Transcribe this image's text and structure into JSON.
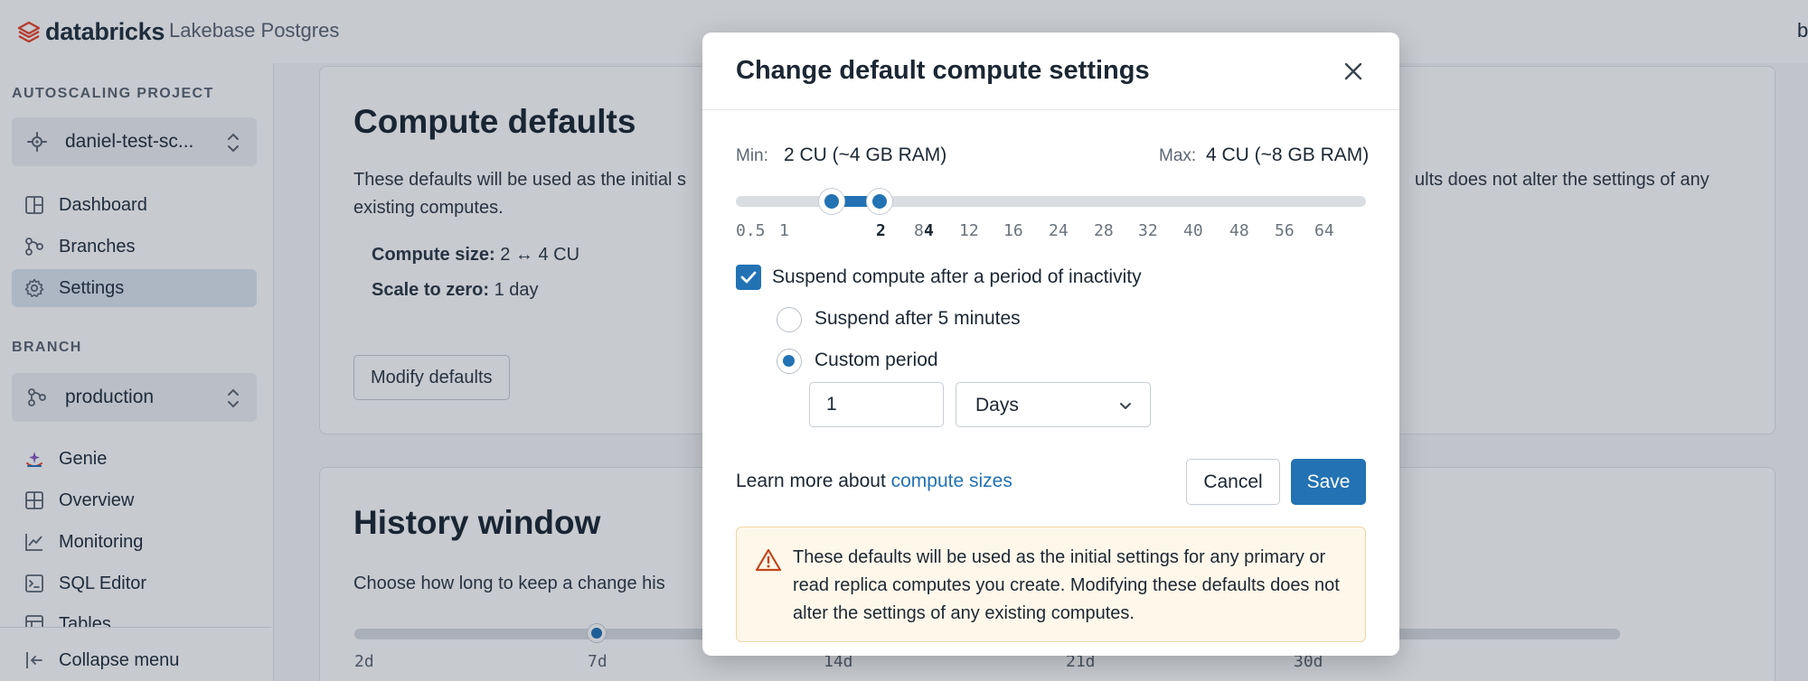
{
  "app": {
    "brand": "databricks",
    "product": "Lakebase Postgres",
    "user_initial": "b"
  },
  "sidebar": {
    "project_section": "AUTOSCALING PROJECT",
    "project_name": "daniel-test-sc...",
    "project_items": [
      {
        "label": "Dashboard",
        "icon": "dashboard-icon"
      },
      {
        "label": "Branches",
        "icon": "branches-icon"
      },
      {
        "label": "Settings",
        "icon": "gear-icon",
        "active": true
      }
    ],
    "branch_section": "BRANCH",
    "branch_name": "production",
    "branch_items": [
      {
        "label": "Genie",
        "icon": "genie-icon"
      },
      {
        "label": "Overview",
        "icon": "overview-icon"
      },
      {
        "label": "Monitoring",
        "icon": "monitoring-icon"
      },
      {
        "label": "SQL Editor",
        "icon": "sql-editor-icon"
      },
      {
        "label": "Tables",
        "icon": "tables-icon"
      }
    ],
    "collapse_label": "Collapse menu"
  },
  "main": {
    "compute": {
      "title": "Compute defaults",
      "description_left": "These defaults will be used as the initial s",
      "description_right": "ults does not alter the settings of any",
      "description_line2": "existing computes.",
      "size_label": "Compute size:",
      "size_value": "2 ↔ 4 CU",
      "scale_label": "Scale to zero:",
      "scale_value": "1 day",
      "modify_button": "Modify defaults"
    },
    "history": {
      "title": "History window",
      "description": "Choose how long to keep a change his",
      "ticks": [
        "2d",
        "7d",
        "14d",
        "21d",
        "30d"
      ]
    }
  },
  "modal": {
    "title": "Change default compute settings",
    "min_label": "Min:",
    "min_value": "2 CU (~4 GB RAM)",
    "max_label": "Max:",
    "max_value": "4 CU (~8 GB RAM)",
    "ticks": [
      "0.5",
      "1",
      "2",
      "4",
      "8",
      "12",
      "16",
      "24",
      "28",
      "32",
      "40",
      "48",
      "56",
      "64"
    ],
    "selected_min": "2",
    "selected_max": "4",
    "suspend_checkbox_label": "Suspend compute after a period of inactivity",
    "suspend_checked": true,
    "radio_5min_label": "Suspend after 5 minutes",
    "radio_custom_label": "Custom period",
    "custom_selected": true,
    "custom_value": "1",
    "custom_unit": "Days",
    "learn_prefix": "Learn more about ",
    "learn_link": "compute sizes",
    "cancel_label": "Cancel",
    "save_label": "Save",
    "warning_text": "These defaults will be used as the initial settings for any primary or read replica computes you create. Modifying these defaults does not alter the settings of any existing computes."
  },
  "colors": {
    "accent": "#2272b4",
    "warning_bg": "#fef7ea",
    "warning_icon": "#c2461b"
  }
}
